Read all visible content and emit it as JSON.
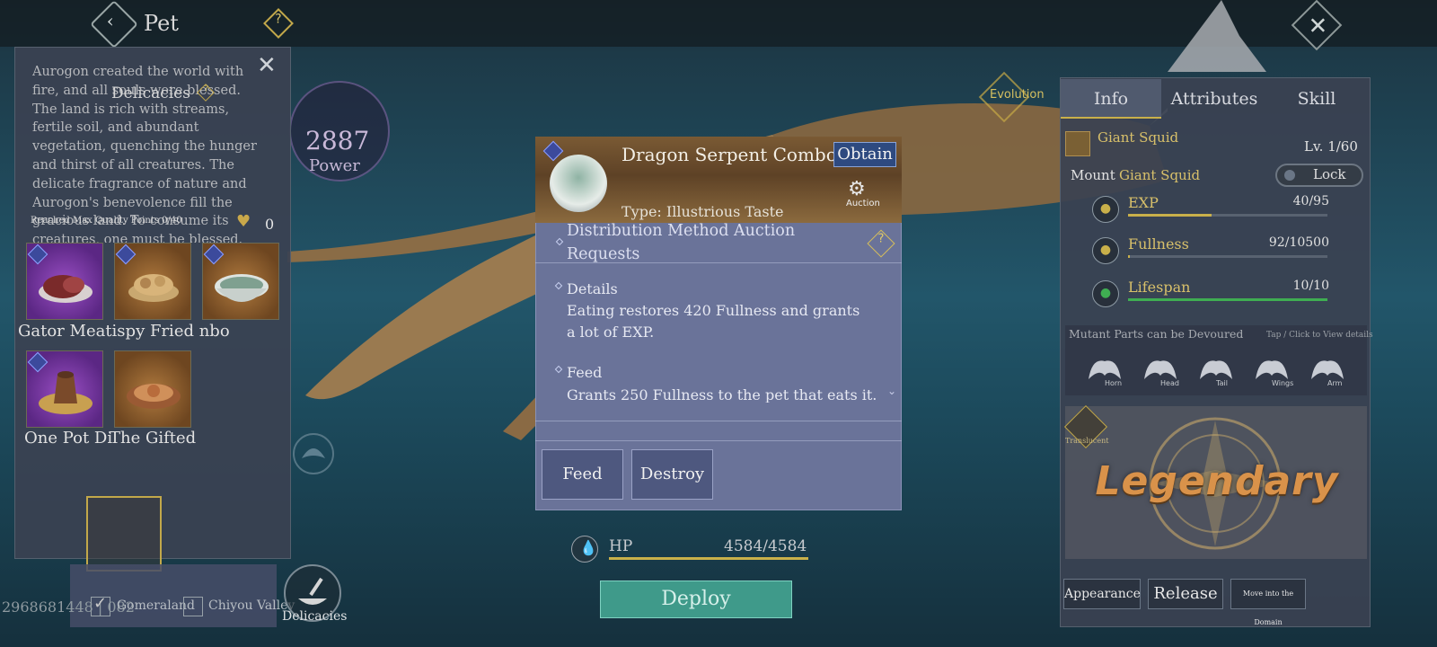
{
  "header": {
    "back_icon": "chevron-left-icon",
    "title": "Pet",
    "help": "?",
    "close": "✕"
  },
  "left_panel": {
    "lore": "Aurogon created the world with fire, and all souls were blessed. The land is rich with streams, fertile soil, and abundant vegetation, quenching the hunger and thirst of all creatures. The delicate fragrance of nature and Aurogon's benevolence fill the gracious land. To consume its creatures, one must be blessed. Fate determines all.",
    "title": "Delicacies",
    "help": "?",
    "close": "✕",
    "quality_text": "Reached Max Quality Points 0/40",
    "quality_count": "0",
    "items": [
      {
        "label": "Gator Meat",
        "rarity": "purple"
      },
      {
        "label": "Crispy Fried",
        "rarity": "orange"
      },
      {
        "label": "Combo",
        "rarity": "orange"
      },
      {
        "label": "One Pot Di",
        "rarity": "purple"
      },
      {
        "label": "The Gifted",
        "rarity": "orange"
      }
    ],
    "label_row1": "Gator Meatispy Fried nbo"
  },
  "power": {
    "value": "2887",
    "label": "Power"
  },
  "evolution": {
    "label": "Evolution"
  },
  "bottom_left": {
    "uid": "2968681448 | 082",
    "region1": "Gomeraland",
    "region2": "Chiyou Valley",
    "delicacies_label": "Delicacies"
  },
  "modal": {
    "title": "Dragon Serpent Combo",
    "obtain": "Obtain",
    "auction_label": "Auction",
    "type": "Type: Illustrious Taste",
    "distribution": "Distribution Method    Auction Requests",
    "details_head": "Details",
    "details_body": "Eating restores 420 Fullness and grants a lot of EXP.",
    "feed_head": "Feed",
    "feed_body": "Grants 250 Fullness to the pet that eats it.",
    "feed_btn": "Feed",
    "destroy_btn": "Destroy",
    "help": "?"
  },
  "hp": {
    "label": "HP",
    "value": "4584/4584",
    "fraction": 1.0
  },
  "deploy": {
    "label": "Deploy"
  },
  "right_panel": {
    "tabs": [
      "Info",
      "Attributes",
      "Skill"
    ],
    "pet_name": "Giant Squid",
    "level": "Lv. 1/60",
    "mount_label": "Mount",
    "mount_name": "Giant Squid",
    "lock": "Lock",
    "stats": [
      {
        "name": "EXP",
        "value": "40/95",
        "fraction": 0.42,
        "color": "#c9b04a",
        "icon": "swirl-icon"
      },
      {
        "name": "Fullness",
        "value": "92/10500",
        "fraction": 0.01,
        "color": "#c9b04a",
        "icon": "stomach-icon"
      },
      {
        "name": "Lifespan",
        "value": "10/10",
        "fraction": 1.0,
        "color": "#3fae52",
        "icon": "heart-icon"
      }
    ],
    "mutant_title": "Mutant Parts can be Devoured",
    "mutant_hint": "Tap / Click to View details",
    "parts": [
      "Horn",
      "Head",
      "Tail",
      "Wings",
      "Arm"
    ],
    "transl_label": "Translucent",
    "rarity": "Legendary",
    "buttons": {
      "appearance": "Appearance",
      "release": "Release",
      "move_domain": "Move into the Domain"
    }
  }
}
